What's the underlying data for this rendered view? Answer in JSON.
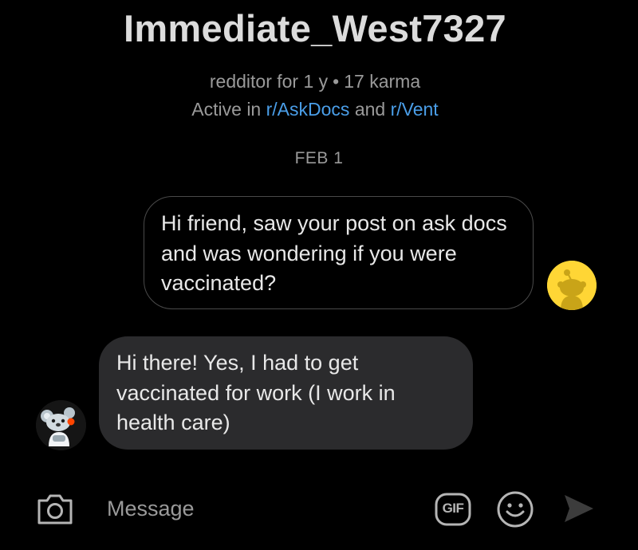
{
  "header": {
    "username": "Immediate_West7327",
    "redditor_for": "redditor for 1 y",
    "separator": "•",
    "karma": "17 karma",
    "active_prefix": "Active in",
    "active_sub_1": "r/AskDocs",
    "active_and": "and",
    "active_sub_2": "r/Vent"
  },
  "conversation": {
    "date_label": "FEB 1",
    "messages": [
      {
        "direction": "outgoing",
        "text": "Hi friend, saw your post on ask docs and was wondering if you were vaccinated?"
      },
      {
        "direction": "incoming",
        "text": "Hi there! Yes, I had to get vaccinated for work (I work in health care)"
      }
    ]
  },
  "composer": {
    "placeholder": "Message",
    "camera_icon": "camera-icon",
    "gif_icon": "gif-icon",
    "gif_label": "GIF",
    "emoji_icon": "emoji-icon",
    "send_icon": "send-icon"
  },
  "colors": {
    "background": "#000000",
    "link": "#4a9ee8",
    "incoming_bubble": "#2b2b2d",
    "outgoing_border": "#4a4a4a",
    "my_avatar_bg": "#ffd635"
  }
}
